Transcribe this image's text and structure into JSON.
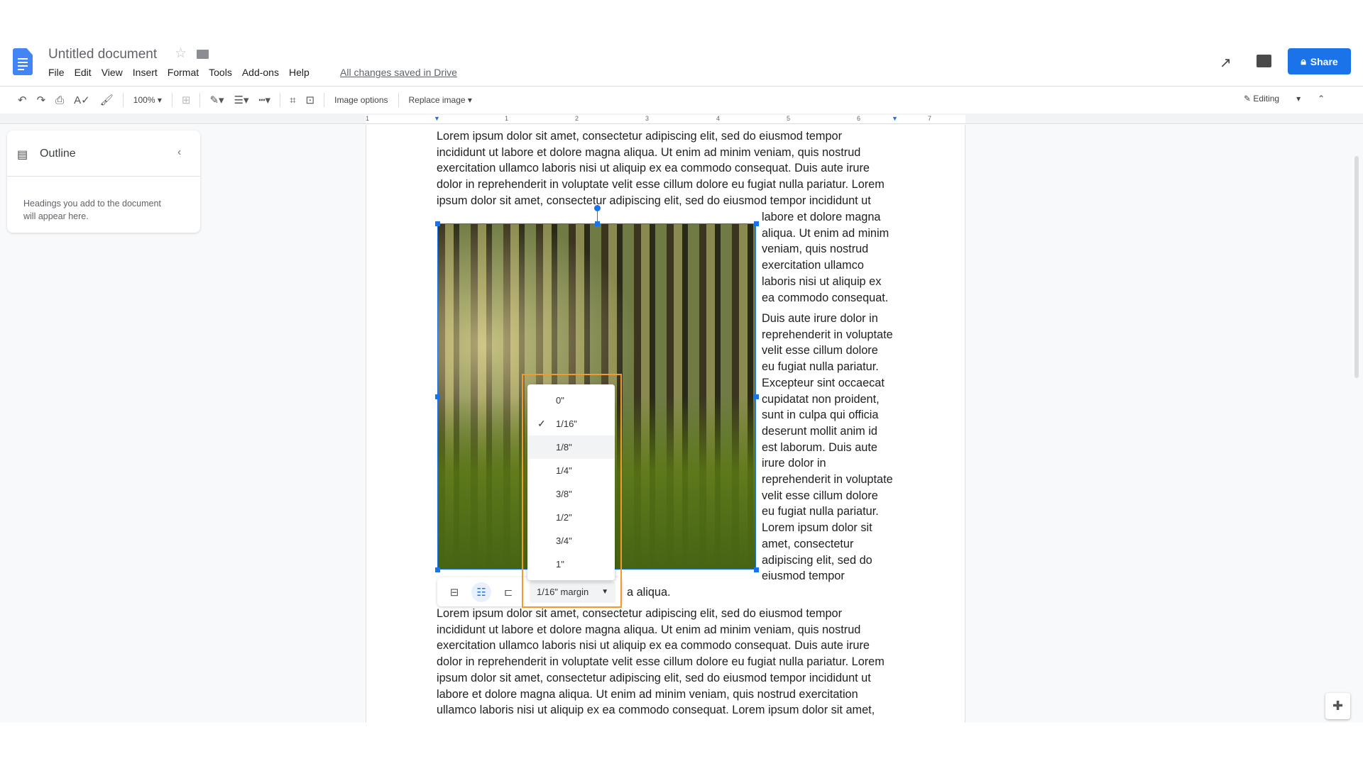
{
  "header": {
    "title": "Untitled document",
    "menu": [
      "File",
      "Edit",
      "View",
      "Insert",
      "Format",
      "Tools",
      "Add-ons",
      "Help"
    ],
    "saved_status": "All changes saved in Drive",
    "share_label": "Share",
    "accent": "#1a73e8"
  },
  "toolbar": {
    "zoom": "100%",
    "image_options": "Image options",
    "replace_image": "Replace image",
    "mode": "Editing"
  },
  "ruler": {
    "marks": [
      "1",
      "1",
      "2",
      "3",
      "4",
      "5",
      "6",
      "7"
    ]
  },
  "outline": {
    "title": "Outline",
    "hint_lines": [
      "Headings you add to the document",
      "will appear here."
    ]
  },
  "doc": {
    "top_lines": [
      "Lorem ipsum dolor sit amet, consectetur adipiscing elit, sed do eiusmod tempor",
      "incididunt ut labore et dolore magna aliqua. Ut enim ad minim veniam, quis nostrud",
      "exercitation ullamco laboris nisi ut aliquip ex ea commodo consequat. Duis aute irure",
      "dolor in reprehenderit in voluptate velit esse cillum dolore eu fugiat nulla pariatur. Lorem",
      "ipsum dolor sit amet, consectetur adipiscing elit, sed do eiusmod tempor incididunt ut"
    ],
    "wrap1": [
      "labore et dolore magna",
      "aliqua. Ut enim ad minim",
      "veniam, quis nostrud",
      "exercitation ullamco",
      "laboris nisi ut aliquip ex",
      "ea commodo consequat."
    ],
    "wrap2": [
      "Duis aute irure dolor in",
      "reprehenderit in voluptate",
      "velit esse cillum dolore",
      "eu fugiat nulla pariatur.",
      "Excepteur sint occaecat",
      "cupidatat non proident,",
      "sunt in culpa qui officia",
      "deserunt mollit anim id",
      "est laborum. Duis aute",
      "irure dolor in",
      "reprehenderit in voluptate",
      "velit esse cillum dolore",
      "eu fugiat nulla pariatur.",
      "Lorem ipsum dolor sit",
      "amet, consectetur",
      "adipiscing elit, sed do",
      "eiusmod tempor"
    ],
    "after_image": "a aliqua.",
    "bottom_lines": [
      "Lorem ipsum dolor sit amet, consectetur adipiscing elit, sed do eiusmod tempor",
      "incididunt ut labore et dolore magna aliqua. Ut enim ad minim veniam, quis nostrud",
      "exercitation ullamco laboris nisi ut aliquip ex ea commodo consequat. Duis aute irure",
      "dolor in reprehenderit in voluptate velit esse cillum dolore eu fugiat nulla pariatur. Lorem",
      "ipsum dolor sit amet, consectetur adipiscing elit, sed do eiusmod tempor incididunt ut",
      "labore et dolore magna aliqua. Ut enim ad minim veniam, quis nostrud exercitation",
      "ullamco laboris nisi ut aliquip ex ea commodo consequat. Lorem ipsum dolor sit amet,"
    ]
  },
  "margin_menu": {
    "options": [
      "0\"",
      "1/16\"",
      "1/8\"",
      "1/4\"",
      "3/8\"",
      "1/2\"",
      "3/4\"",
      "1\""
    ],
    "selected": "1/16\"",
    "hovered": "1/8\"",
    "button_label": "1/16\" margin"
  },
  "image_wrap": {
    "active": "wrap-text"
  },
  "highlight_color": "#f29b2b"
}
